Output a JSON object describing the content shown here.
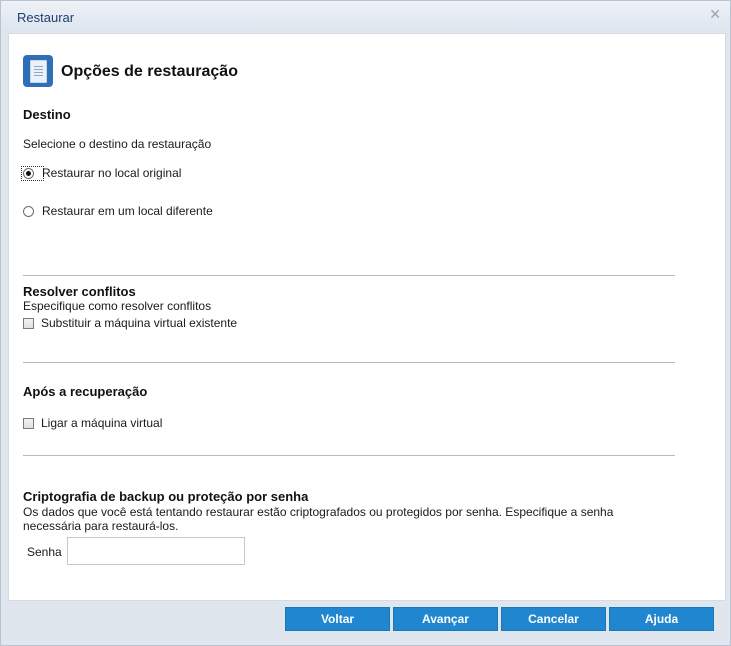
{
  "window": {
    "title": "Restaurar",
    "close_glyph": "✕"
  },
  "header": {
    "icon": "document-stack-icon",
    "title": "Opções de restauração"
  },
  "destination": {
    "title": "Destino",
    "prompt": "Selecione o destino da restauração",
    "options": [
      {
        "label": "Restaurar no local original",
        "checked": true
      },
      {
        "label": "Restaurar em um local diferente",
        "checked": false
      }
    ]
  },
  "conflicts": {
    "title": "Resolver conflitos",
    "subtitle": "Especifique como resolver conflitos",
    "checkbox_label": "Substituir a máquina virtual existente"
  },
  "after_recovery": {
    "title": "Após a recuperação",
    "checkbox_label": "Ligar a máquina virtual"
  },
  "encryption": {
    "title": "Criptografia de backup ou proteção por senha",
    "description_line1": "Os dados que você está tentando restaurar estão criptografados ou protegidos por senha. Especifique a senha",
    "description_line2": "necessária para restaurá-los.",
    "password_label": "Senha",
    "password_value": ""
  },
  "footer": {
    "back": "Voltar",
    "next": "Avançar",
    "cancel": "Cancelar",
    "help": "Ajuda"
  },
  "colors": {
    "button": "#1f86cf",
    "title_text": "#1f3d70"
  }
}
